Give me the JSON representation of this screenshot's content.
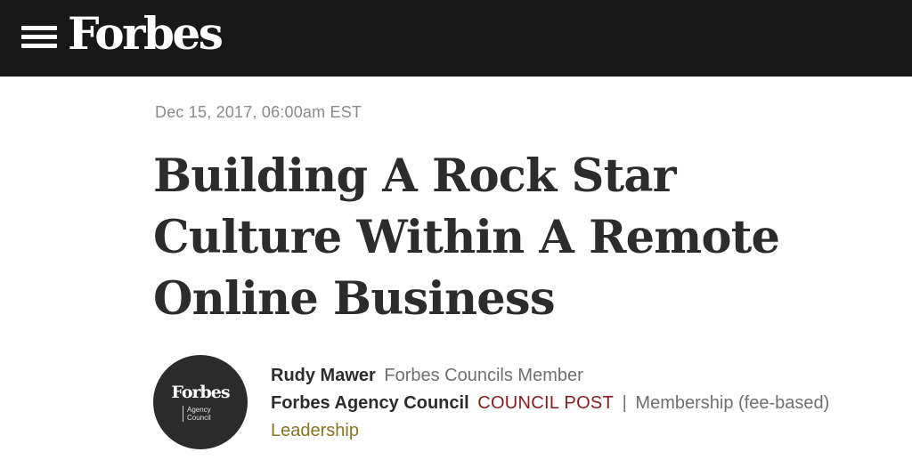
{
  "header": {
    "logo": "Forbes"
  },
  "article": {
    "dateline": "Dec 15, 2017, 06:00am EST",
    "headline": "Building A Rock Star Culture Within A Remote Online Business"
  },
  "author_box": {
    "avatar_logo": "Forbes",
    "avatar_sub_line1": "Agency",
    "avatar_sub_line2": "Council",
    "author_name": "Rudy Mawer",
    "author_role": "Forbes Councils Member",
    "council_name": "Forbes Agency Council",
    "council_post_label": "COUNCIL POST",
    "separator": "|",
    "membership": "Membership (fee-based)",
    "channel": "Leadership"
  },
  "colors": {
    "topbar_bg": "#181818",
    "council_post": "#8b1a1a",
    "channel_link": "#8a7420"
  },
  "icons": {
    "menu": "hamburger-menu-icon"
  }
}
